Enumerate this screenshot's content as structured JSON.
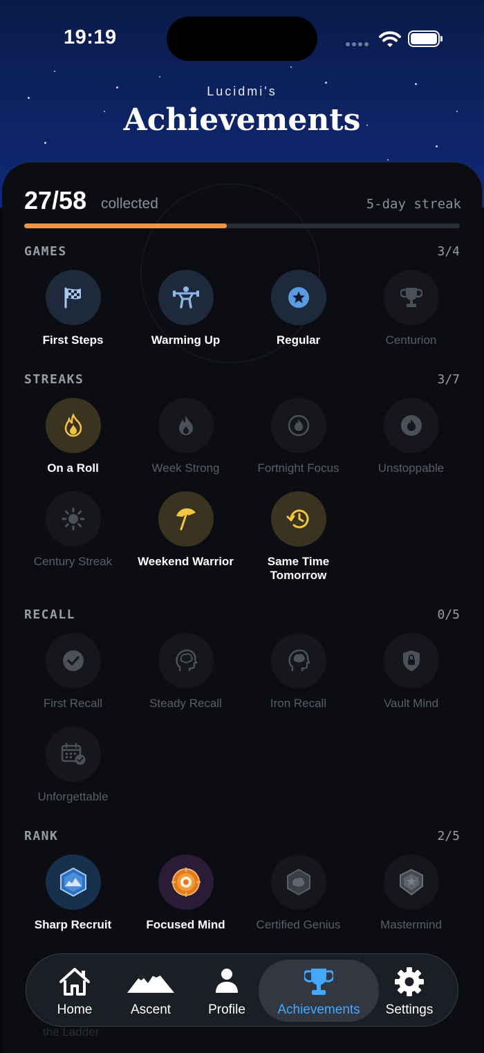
{
  "status_bar": {
    "time": "19:19"
  },
  "header": {
    "owner": "Lucidmi's",
    "title": "Achievements"
  },
  "progress": {
    "count": "27/58",
    "label": "collected",
    "streak": "5-day streak",
    "fraction": 0.4655
  },
  "colors": {
    "accent": "#ee9641",
    "active_tab": "#45a8ff",
    "earned_gold_bg": "#3a3320",
    "earned_blue_bg": "#1e2a3c"
  },
  "sections": {
    "games": {
      "title": "GAMES",
      "count": "3/4",
      "badges": [
        {
          "label": "First Steps",
          "icon": "checkered-flag-icon"
        },
        {
          "label": "Warming Up",
          "icon": "weightlifter-icon"
        },
        {
          "label": "Regular",
          "icon": "star-circle-icon"
        },
        {
          "label": "Centurion",
          "icon": "trophy-icon"
        }
      ]
    },
    "streaks": {
      "title": "STREAKS",
      "count": "3/7",
      "badges": [
        {
          "label": "On a Roll",
          "icon": "flame-icon"
        },
        {
          "label": "Week Strong",
          "icon": "flame-drop-icon"
        },
        {
          "label": "Fortnight Focus",
          "icon": "flame-ring-icon"
        },
        {
          "label": "Unstoppable",
          "icon": "flame-circle-icon"
        },
        {
          "label": "Century Streak",
          "icon": "sun-icon"
        },
        {
          "label": "Weekend Warrior",
          "icon": "beach-umbrella-icon"
        },
        {
          "label": "Same Time Tomorrow",
          "icon": "clock-history-icon"
        }
      ]
    },
    "recall": {
      "title": "RECALL",
      "count": "0/5",
      "badges": [
        {
          "label": "First Recall",
          "icon": "check-circle-icon"
        },
        {
          "label": "Steady Recall",
          "icon": "head-brain-icon"
        },
        {
          "label": "Iron Recall",
          "icon": "head-brain-gear-icon"
        },
        {
          "label": "Vault Mind",
          "icon": "lock-shield-icon"
        },
        {
          "label": "Unforgettable",
          "icon": "calendar-check-icon"
        }
      ]
    },
    "rank": {
      "title": "RANK",
      "count": "2/5",
      "badges": [
        {
          "label": "Sharp Recruit",
          "icon": "blue-hex-emblem-icon"
        },
        {
          "label": "Focused Mind",
          "icon": "orange-target-emblem-icon"
        },
        {
          "label": "Certified Genius",
          "icon": "gray-hex-emblem-icon"
        },
        {
          "label": "Mastermind",
          "icon": "gray-shield-emblem-icon"
        }
      ]
    }
  },
  "below_nav_text": "the Ladder",
  "nav": {
    "items": [
      {
        "label": "Home",
        "icon": "house-icon"
      },
      {
        "label": "Ascent",
        "icon": "mountains-icon"
      },
      {
        "label": "Profile",
        "icon": "person-icon"
      },
      {
        "label": "Achievements",
        "icon": "trophy-icon"
      },
      {
        "label": "Settings",
        "icon": "gear-icon"
      }
    ]
  }
}
